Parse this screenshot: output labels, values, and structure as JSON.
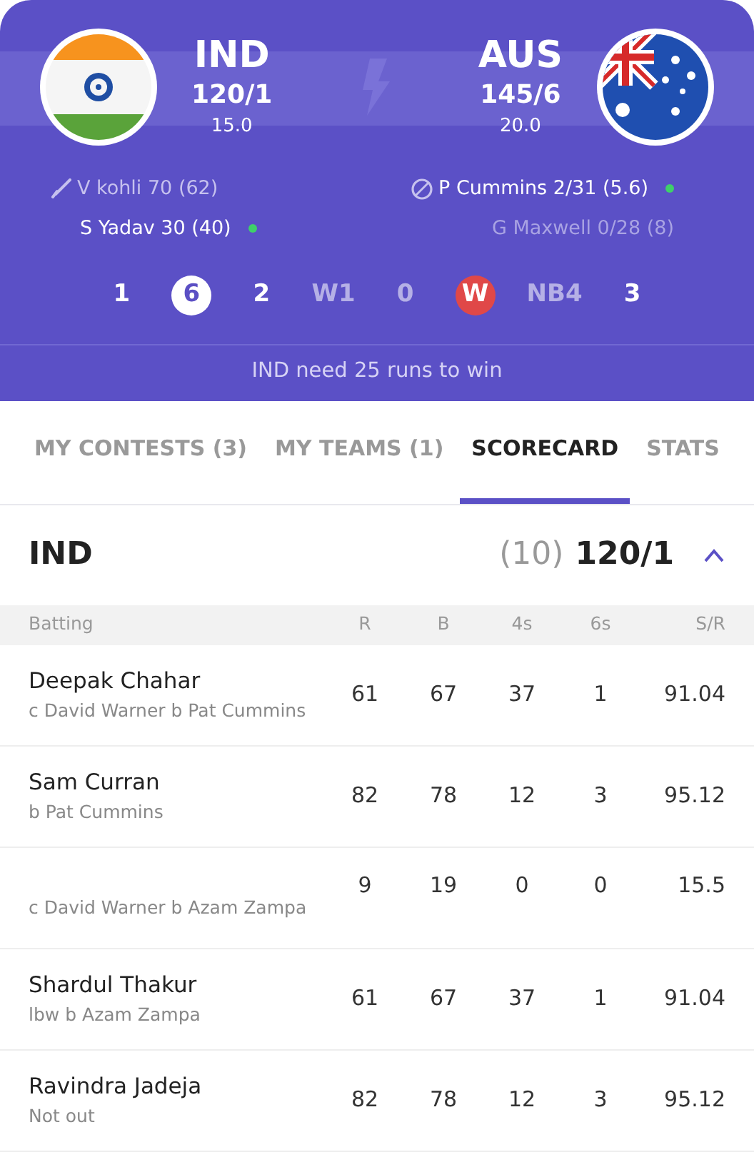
{
  "match": {
    "home": {
      "code": "IND",
      "score": "120/1",
      "overs": "15.0"
    },
    "away": {
      "code": "AUS",
      "score": "145/6",
      "overs": "20.0"
    }
  },
  "batters": [
    {
      "text": "V kohli 70 (62)",
      "active": false
    },
    {
      "text": "S Yadav 30 (40)",
      "active": true
    }
  ],
  "bowlers": [
    {
      "text": "P Cummins 2/31 (5.6)",
      "active": true
    },
    {
      "text": "G Maxwell 0/28 (8)",
      "active": false
    }
  ],
  "balls": [
    {
      "label": "1",
      "kind": "run"
    },
    {
      "label": "6",
      "kind": "six"
    },
    {
      "label": "2",
      "kind": "run"
    },
    {
      "label": "W1",
      "kind": "muted"
    },
    {
      "label": "0",
      "kind": "muted"
    },
    {
      "label": "W",
      "kind": "wicket"
    },
    {
      "label": "NB4",
      "kind": "muted"
    },
    {
      "label": "3",
      "kind": "run"
    }
  ],
  "status": "IND need 25 runs to win",
  "tabs": [
    {
      "label": "MY CONTESTS (3)",
      "selected": false
    },
    {
      "label": "MY TEAMS (1)",
      "selected": false
    },
    {
      "label": "SCORECARD",
      "selected": true
    },
    {
      "label": "STATS",
      "selected": false
    }
  ],
  "innings": {
    "team": "IND",
    "overs": "(10)",
    "score": "120/1",
    "expanded": true
  },
  "table": {
    "columns": [
      "Batting",
      "R",
      "B",
      "4s",
      "6s",
      "S/R"
    ],
    "rows": [
      {
        "cells": [
          {
            "name": "Deepak Chahar",
            "dismissal": "c David Warner b Pat Cummins"
          },
          "61",
          "67",
          "37",
          "1",
          "91.04"
        ]
      },
      {
        "cells": [
          {
            "name": "Sam Curran",
            "dismissal": "b Pat Cummins"
          },
          "82",
          "78",
          "12",
          "3",
          "95.12"
        ]
      },
      {
        "cells": [
          {
            "dismissal": "c David Warner b Azam Zampa"
          },
          "9",
          "19",
          "0",
          "0",
          "15.5"
        ]
      },
      {
        "cells": [
          {
            "name": "Shardul Thakur",
            "dismissal": "lbw b Azam Zampa"
          },
          "61",
          "67",
          "37",
          "1",
          "91.04"
        ]
      },
      {
        "cells": [
          {
            "name": "Ravindra Jadeja",
            "dismissal": "Not out"
          },
          "82",
          "78",
          "12",
          "3",
          "95.12"
        ]
      }
    ]
  }
}
